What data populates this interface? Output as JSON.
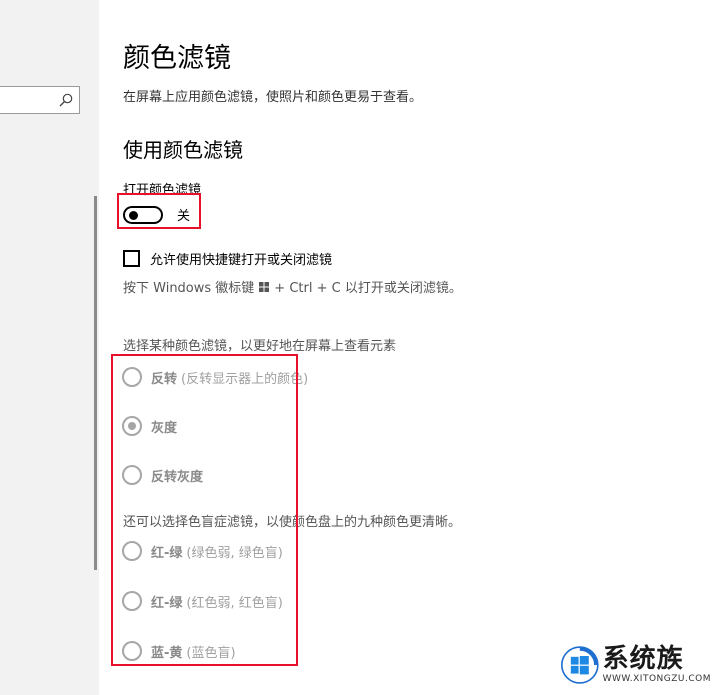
{
  "page": {
    "title": "颜色滤镜",
    "description": "在屏幕上应用颜色滤镜，使照片和颜色更易于查看。",
    "section_title": "使用颜色滤镜"
  },
  "toggle": {
    "label": "打开颜色滤镜",
    "state_text": "关",
    "on": false
  },
  "shortcut": {
    "checkbox_label": "允许使用快捷键打开或关闭滤镜",
    "checked": false,
    "hint_before": "按下 Windows 徽标键",
    "hint_after": "+ Ctrl + C 以打开或关闭滤镜。"
  },
  "filters": {
    "heading": "选择某种颜色滤镜，以更好地在屏幕上查看元素",
    "options": [
      {
        "label": "反转",
        "sub": "(反转显示器上的颜色)",
        "selected": false
      },
      {
        "label": "灰度",
        "sub": "",
        "selected": true
      },
      {
        "label": "反转灰度",
        "sub": "",
        "selected": false
      }
    ]
  },
  "colorblind": {
    "heading": "还可以选择色盲症滤镜，以使颜色盘上的九种颜色更清晰。",
    "options": [
      {
        "label": "红-绿",
        "sub": "(绿色弱, 绿色盲)",
        "selected": false
      },
      {
        "label": "红-绿",
        "sub": "(红色弱, 红色盲)",
        "selected": false
      },
      {
        "label": "蓝-黄",
        "sub": "(蓝色盲)",
        "selected": false
      }
    ]
  },
  "watermark": {
    "name": "系统族",
    "url": "WWW.XITONGZU.COM"
  },
  "colors": {
    "highlight": "#e8102a",
    "sidebar_bg": "#f2f2f2",
    "disabled": "#a6a6a6"
  }
}
